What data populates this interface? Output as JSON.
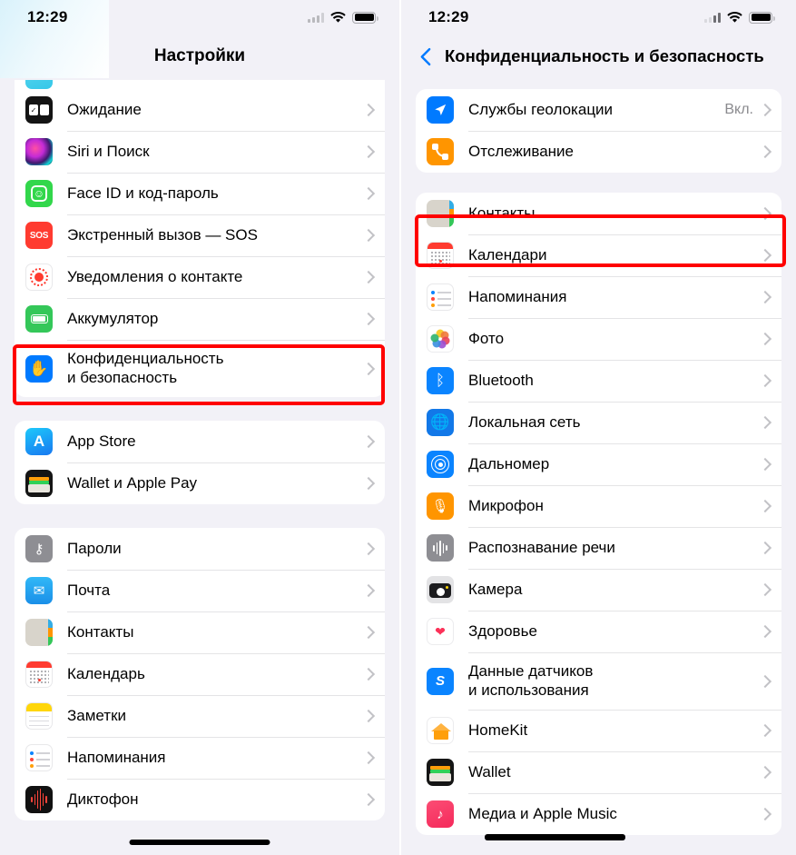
{
  "left_screen": {
    "status_bar": {
      "time": "12:29",
      "wifi_icon": "wifi-icon",
      "battery_icon": "battery-icon",
      "signal_icon": "cellular-signal-icon"
    },
    "nav": {
      "title": "Настройки"
    },
    "sections": [
      {
        "id": "section-system",
        "rows": [
          {
            "icon": "standby-icon",
            "label": "Ожидание",
            "value": ""
          },
          {
            "icon": "siri-icon",
            "label": "Siri и Поиск",
            "value": ""
          },
          {
            "icon": "faceid-icon",
            "label": "Face ID и код-пароль",
            "value": ""
          },
          {
            "icon": "sos-icon",
            "label": "Экстренный вызов — SOS",
            "value": ""
          },
          {
            "icon": "contact-notification-icon",
            "label": "Уведомления о контакте",
            "value": ""
          },
          {
            "icon": "battery-app-icon",
            "label": "Аккумулятор",
            "value": ""
          },
          {
            "icon": "privacy-hand-icon",
            "label": "Конфиденциальность\nи безопасность",
            "value": "",
            "highlighted": true
          }
        ]
      },
      {
        "id": "section-store",
        "rows": [
          {
            "icon": "app-store-icon",
            "label": "App Store",
            "value": ""
          },
          {
            "icon": "wallet-icon",
            "label": "Wallet и Apple Pay",
            "value": ""
          }
        ]
      },
      {
        "id": "section-apps",
        "rows": [
          {
            "icon": "passwords-key-icon",
            "label": "Пароли",
            "value": ""
          },
          {
            "icon": "mail-icon",
            "label": "Почта",
            "value": ""
          },
          {
            "icon": "contacts-icon",
            "label": "Контакты",
            "value": ""
          },
          {
            "icon": "calendar-icon",
            "label": "Календарь",
            "value": ""
          },
          {
            "icon": "notes-icon",
            "label": "Заметки",
            "value": ""
          },
          {
            "icon": "reminders-icon",
            "label": "Напоминания",
            "value": ""
          },
          {
            "icon": "voice-memos-icon",
            "label": "Диктофон",
            "value": ""
          }
        ]
      }
    ],
    "highlight_color": "#ff0000"
  },
  "right_screen": {
    "status_bar": {
      "time": "12:29",
      "wifi_icon": "wifi-icon",
      "battery_icon": "battery-icon",
      "signal_icon": "cellular-signal-icon"
    },
    "nav": {
      "back_icon": "back-chevron-icon",
      "title": "Конфиденциальность и безопасность"
    },
    "sections": [
      {
        "id": "section-location",
        "rows": [
          {
            "icon": "location-services-icon",
            "label": "Службы геолокации",
            "value": "Вкл."
          },
          {
            "icon": "tracking-icon",
            "label": "Отслеживание",
            "value": ""
          }
        ]
      },
      {
        "id": "section-permissions",
        "rows": [
          {
            "icon": "contacts-icon",
            "label": "Контакты",
            "value": "",
            "highlighted": true
          },
          {
            "icon": "calendar-icon",
            "label": "Календари",
            "value": ""
          },
          {
            "icon": "reminders-icon",
            "label": "Напоминания",
            "value": ""
          },
          {
            "icon": "photos-icon",
            "label": "Фото",
            "value": ""
          },
          {
            "icon": "bluetooth-icon",
            "label": "Bluetooth",
            "value": ""
          },
          {
            "icon": "local-network-icon",
            "label": "Локальная сеть",
            "value": ""
          },
          {
            "icon": "measure-icon",
            "label": "Дальномер",
            "value": ""
          },
          {
            "icon": "microphone-icon",
            "label": "Микрофон",
            "value": ""
          },
          {
            "icon": "speech-recognition-icon",
            "label": "Распознавание речи",
            "value": ""
          },
          {
            "icon": "camera-icon",
            "label": "Камера",
            "value": ""
          },
          {
            "icon": "health-icon",
            "label": "Здоровье",
            "value": ""
          },
          {
            "icon": "sensor-data-icon",
            "label": "Данные датчиков\nи использования",
            "value": ""
          },
          {
            "icon": "homekit-icon",
            "label": "HomeKit",
            "value": ""
          },
          {
            "icon": "wallet-icon",
            "label": "Wallet",
            "value": ""
          },
          {
            "icon": "apple-music-icon",
            "label": "Медиа и Apple Music",
            "value": ""
          }
        ]
      }
    ],
    "highlight_color": "#ff0000"
  }
}
